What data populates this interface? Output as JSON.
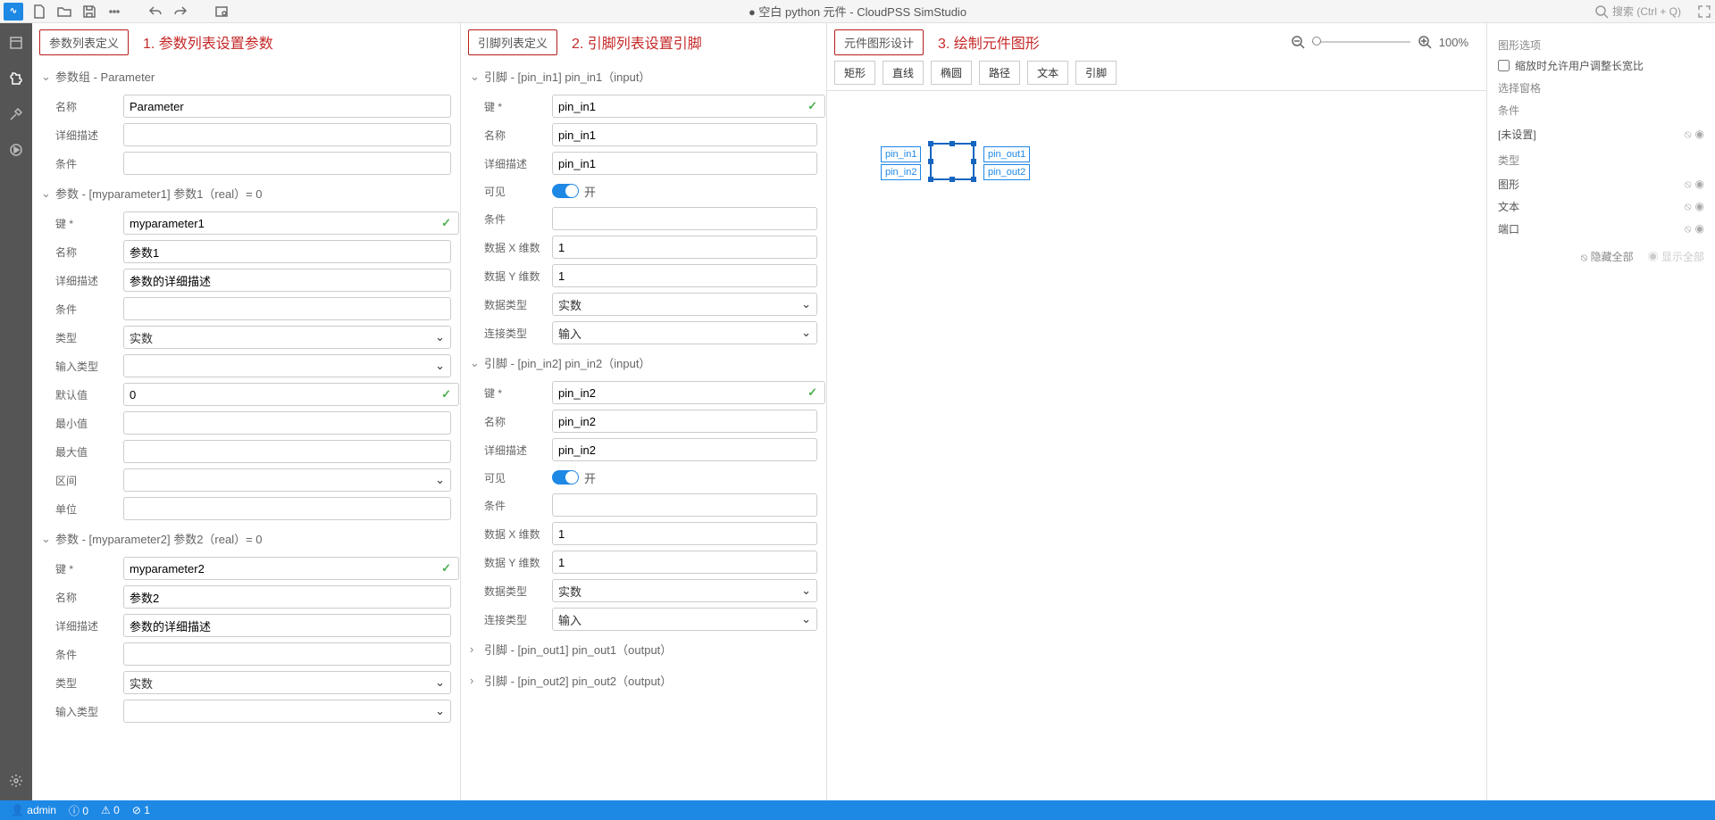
{
  "title": "● 空白 python 元件 - CloudPSS SimStudio",
  "search_placeholder": "搜索 (Ctrl + Q)",
  "col1": {
    "tab": "参数列表定义",
    "annot": "1. 参数列表设置参数",
    "group_head": "参数组 - Parameter",
    "lbl_name": "名称",
    "val_name": "Parameter",
    "lbl_desc": "详细描述",
    "lbl_cond": "条件",
    "p1_head": "参数 - [myparameter1] 参数1（real）= 0",
    "lbl_key": "键 *",
    "p1_key": "myparameter1",
    "p1_name": "参数1",
    "p1_desc": "参数的详细描述",
    "lbl_type": "类型",
    "p1_type": "实数",
    "lbl_intype": "输入类型",
    "lbl_default": "默认值",
    "p1_default": "0",
    "lbl_min": "最小值",
    "lbl_max": "最大值",
    "lbl_range": "区间",
    "lbl_unit": "单位",
    "p2_head": "参数 - [myparameter2] 参数2（real）= 0",
    "p2_key": "myparameter2",
    "p2_name": "参数2",
    "p2_desc": "参数的详细描述",
    "p2_type": "实数"
  },
  "col2": {
    "tab": "引脚列表定义",
    "annot": "2. 引脚列表设置引脚",
    "pin1_head": "引脚 - [pin_in1] pin_in1（input）",
    "lbl_key": "键 *",
    "lbl_name": "名称",
    "lbl_desc": "详细描述",
    "lbl_vis": "可见",
    "lbl_cond": "条件",
    "lbl_dimx": "数据 X 维数",
    "lbl_dimy": "数据 Y 维数",
    "lbl_dtype": "数据类型",
    "lbl_ctype": "连接类型",
    "pin1_key": "pin_in1",
    "pin1_name": "pin_in1",
    "pin1_desc": "pin_in1",
    "vis_on": "开",
    "dim_val": "1",
    "dtype": "实数",
    "ctype": "输入",
    "pin2_head": "引脚 - [pin_in2] pin_in2（input）",
    "pin2_key": "pin_in2",
    "pin2_name": "pin_in2",
    "pin2_desc": "pin_in2",
    "pin3_head": "引脚 - [pin_out1] pin_out1（output）",
    "pin4_head": "引脚 - [pin_out2] pin_out2（output）"
  },
  "col3": {
    "tab": "元件图形设计",
    "annot": "3. 绘制元件图形",
    "tools": {
      "rect": "矩形",
      "line": "直线",
      "ellipse": "椭圆",
      "path": "路径",
      "text": "文本",
      "pin": "引脚"
    },
    "zoom": "100%",
    "pins": {
      "in1": "pin_in1",
      "in2": "pin_in2",
      "out1": "pin_out1",
      "out2": "pin_out2"
    }
  },
  "props": {
    "opts": "图形选项",
    "scale_cb": "缩放时允许用户调整长宽比",
    "selgrid": "选择窗格",
    "cond": "条件",
    "cond_val": "[未设置]",
    "typ": "类型",
    "shape": "图形",
    "text": "文本",
    "port": "端口",
    "hide": "隐藏全部",
    "show": "显示全部"
  },
  "status": {
    "user": "admin",
    "i": "0",
    "w": "0",
    "e": "1"
  },
  "icons": {
    "user": "👤",
    "info": "ⓘ",
    "warn": "⚠",
    "err": "⊘"
  }
}
